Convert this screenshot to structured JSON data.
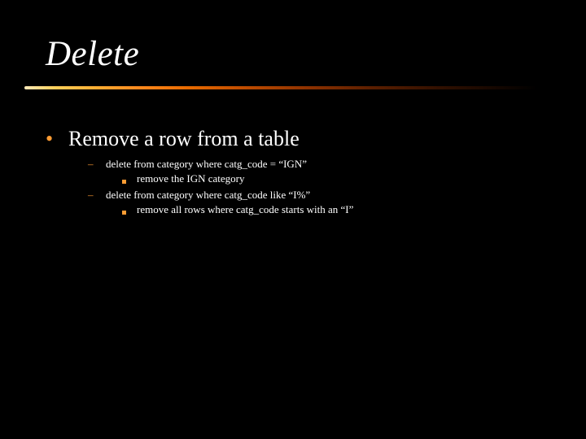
{
  "title": "Delete",
  "bullets": {
    "lvl1": {
      "text": "Remove a row from a table"
    },
    "sub": [
      {
        "text": "delete from category where catg_code = “IGN”",
        "children": [
          {
            "text": "remove the IGN category"
          }
        ]
      },
      {
        "text": "delete from category where catg_code like “I%”",
        "children": [
          {
            "text": "remove all rows where catg_code starts with an “I”"
          }
        ]
      }
    ]
  }
}
